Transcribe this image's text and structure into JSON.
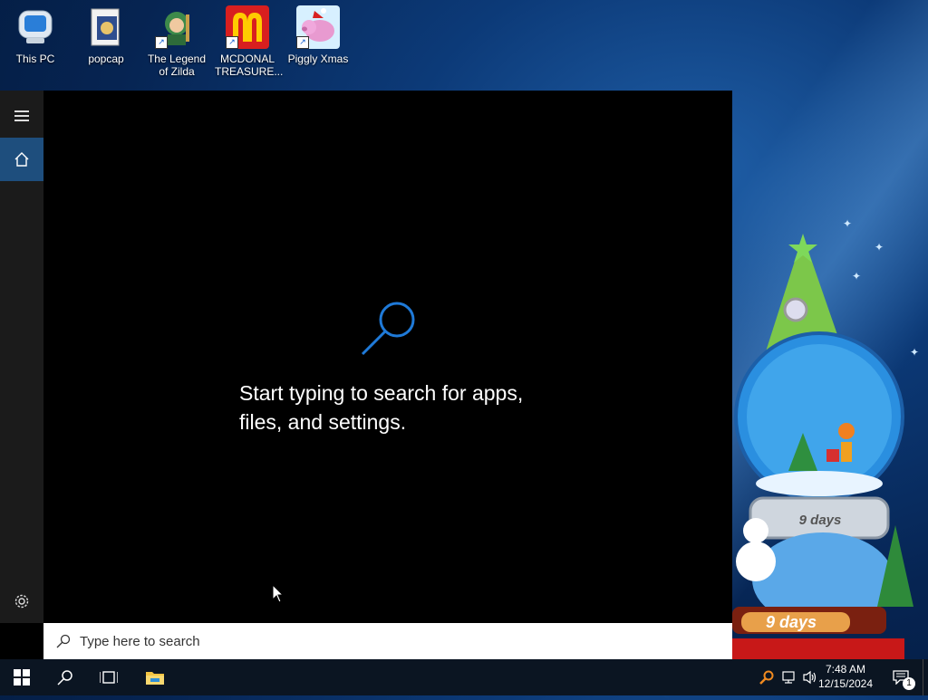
{
  "desktop": {
    "icons": [
      {
        "label": "This PC",
        "icon": "this-pc-icon"
      },
      {
        "label": "popcap",
        "icon": "popcap-folder-icon"
      },
      {
        "label": "The Legend of Zilda",
        "icon": "legend-of-zilda-icon"
      },
      {
        "label": "MCDONAL TREASURE...",
        "icon": "mcdonald-treasure-icon"
      },
      {
        "label": "Piggly Xmas",
        "icon": "piggly-xmas-icon"
      }
    ]
  },
  "start": {
    "hero_text": "Start typing to search for apps, files, and settings.",
    "search_placeholder": "Type here to search"
  },
  "decoration": {
    "countdown_top": "9 days",
    "countdown_bottom": "9 days"
  },
  "taskbar": {
    "time": "7:48 AM",
    "date": "12/15/2024",
    "notification_count": "1"
  },
  "colors": {
    "accent": "#1e4e7d",
    "search_blue": "#1f7ad8",
    "taskbar": "#0b1522"
  }
}
